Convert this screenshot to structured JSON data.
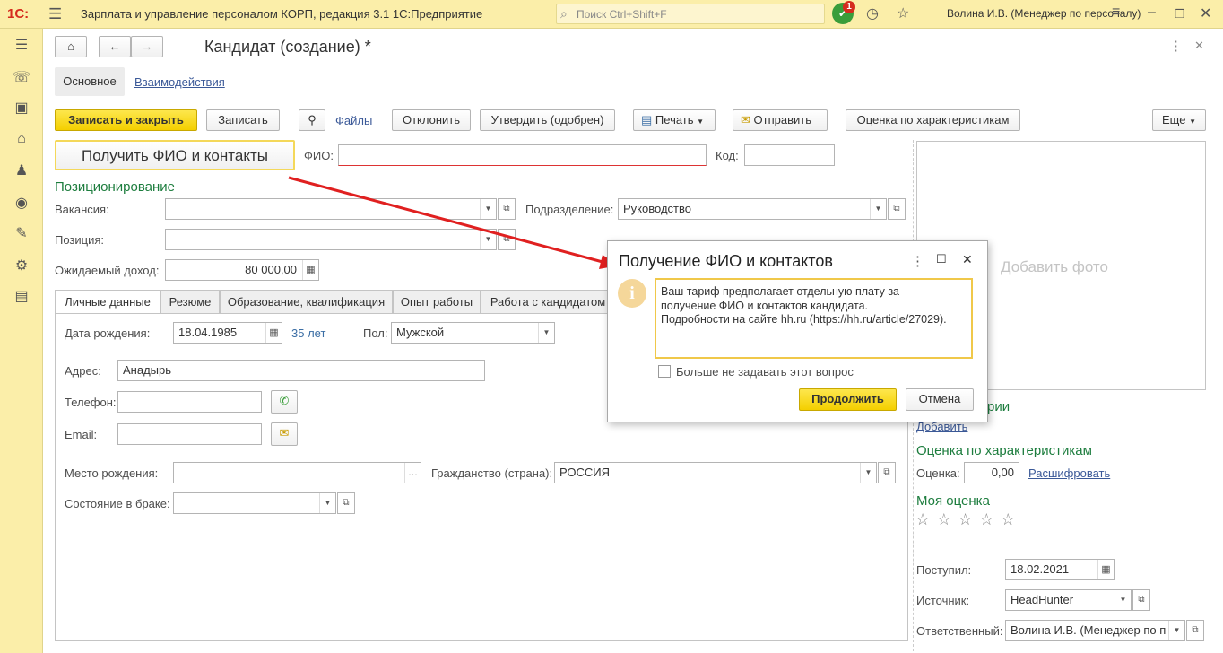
{
  "app": {
    "logo": "1С:",
    "title": "Зарплата и управление персоналом КОРП, редакция 3.1 1С:Предприятие",
    "search_placeholder": "Поиск Ctrl+Shift+F",
    "notifications_count": "1",
    "user": "Волина И.В. (Менеджер по персоналу)"
  },
  "form": {
    "title": "Кандидат (создание) *",
    "nav_tabs": [
      "Основное",
      "Взаимодействия"
    ],
    "toolbar": {
      "save_close": "Записать и закрыть",
      "save": "Записать",
      "files": "Файлы",
      "reject": "Отклонить",
      "approve": "Утвердить (одобрен)",
      "print": "Печать",
      "send": "Отправить",
      "rating": "Оценка по характеристикам",
      "more": "Еще"
    },
    "get_contacts_button": "Получить ФИО и контакты",
    "fio_label": "ФИО:",
    "fio_value": "",
    "code_label": "Код:",
    "code_value": "",
    "positioning": {
      "section_title": "Позиционирование",
      "vacancy_label": "Вакансия:",
      "vacancy_value": "",
      "department_label": "Подразделение:",
      "department_value": "Руководство",
      "position_label": "Позиция:",
      "position_value": "",
      "income_label": "Ожидаемый доход:",
      "income_value": "80 000,00"
    },
    "tabs": [
      "Личные данные",
      "Резюме",
      "Образование, квалификация",
      "Опыт работы",
      "Работа с кандидатом"
    ],
    "personal": {
      "birth_label": "Дата рождения:",
      "birth_value": "18.04.1985",
      "age": "35 лет",
      "gender_label": "Пол:",
      "gender_value": "Мужской",
      "address_label": "Адрес:",
      "address_value": "Анадырь",
      "phone_label": "Телефон:",
      "phone_value": "",
      "email_label": "Email:",
      "email_value": "",
      "birthplace_label": "Место рождения:",
      "birthplace_value": "",
      "citizenship_label": "Гражданство (страна):",
      "citizenship_value": "РОССИЯ",
      "marital_label": "Состояние в браке:",
      "marital_value": ""
    },
    "right_panel": {
      "photo_placeholder": "Добавить фото",
      "section_partial": "рии",
      "add_link": "Добавить",
      "rating_title": "Оценка по характеристикам",
      "rating_label": "Оценка:",
      "rating_value": "0,00",
      "decode_link": "Расшифровать",
      "my_rating_title": "Моя оценка",
      "stars_selected": 0,
      "stars_total": 5,
      "received_label": "Поступил:",
      "received_value": "18.02.2021",
      "source_label": "Источник:",
      "source_value": "HeadHunter",
      "responsible_label": "Ответственный:",
      "responsible_value": "Волина И.В. (Менеджер по п"
    }
  },
  "dialog": {
    "title": "Получение ФИО и контактов",
    "message_line1": "Ваш тариф предполагает отдельную плату за",
    "message_line2": "получение ФИО и контактов кандидата.",
    "message_line3": "Подробности на сайте hh.ru (https://hh.ru/article/27029).",
    "checkbox_label": "Больше не задавать этот вопрос",
    "continue_button": "Продолжить",
    "cancel_button": "Отмена"
  },
  "colors": {
    "header_bg": "#fbeea9",
    "accent_yellow": "#f4cf00",
    "section_green": "#1d7d3e",
    "link_blue": "#3b5998",
    "arrow_red": "#e02020"
  }
}
